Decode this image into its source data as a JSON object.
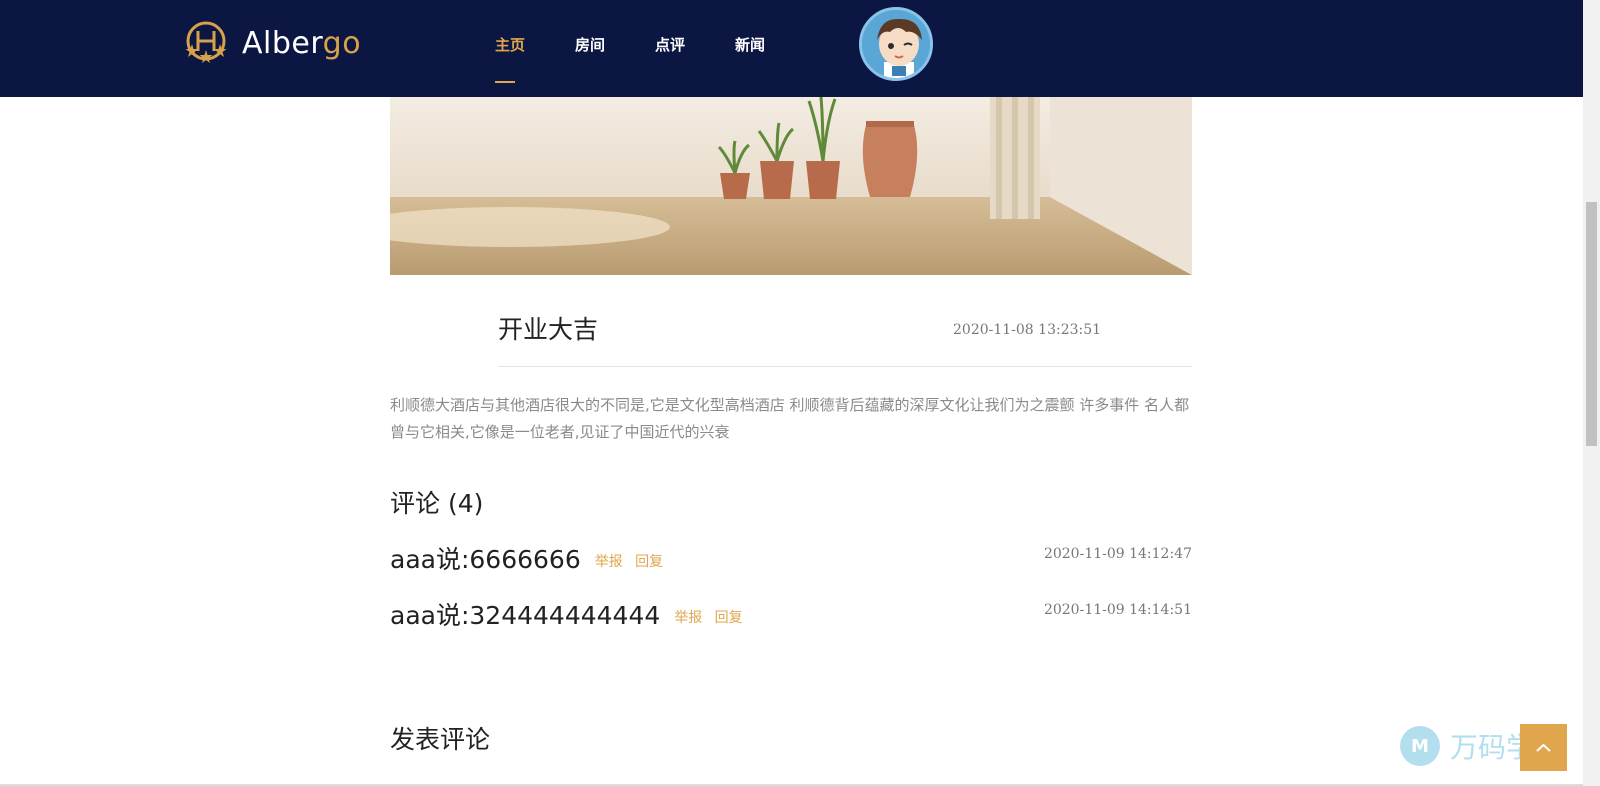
{
  "brand": {
    "name_main": "Alber",
    "name_accent": "go"
  },
  "nav": {
    "items": [
      {
        "label": "主页",
        "active": true
      },
      {
        "label": "房间",
        "active": false
      },
      {
        "label": "点评",
        "active": false
      },
      {
        "label": "新闻",
        "active": false
      }
    ]
  },
  "article": {
    "title": "开业大吉",
    "date": "2020-11-08 13:23:51",
    "body": "利顺德大酒店与其他酒店很大的不同是,它是文化型高档酒店 利顺德背后蕴藏的深厚文化让我们为之震颤 许多事件 名人都曾与它相关,它像是一位老者,见证了中国近代的兴衰"
  },
  "comments": {
    "heading": "评论 (4)",
    "items": [
      {
        "text": "aaa说:6666666",
        "report": "举报",
        "reply": "回复",
        "date": "2020-11-09 14:12:47"
      },
      {
        "text": "aaa说:324444444444",
        "report": "举报",
        "reply": "回复",
        "date": "2020-11-09 14:14:51"
      }
    ]
  },
  "post_comment": {
    "heading": "发表评论"
  },
  "watermark": {
    "logo": "M",
    "text": "万码学堂"
  },
  "colors": {
    "navbar": "#0c1642",
    "accent": "#e0a64e"
  },
  "icons": {
    "back_to_top": "chevron-up-icon"
  }
}
